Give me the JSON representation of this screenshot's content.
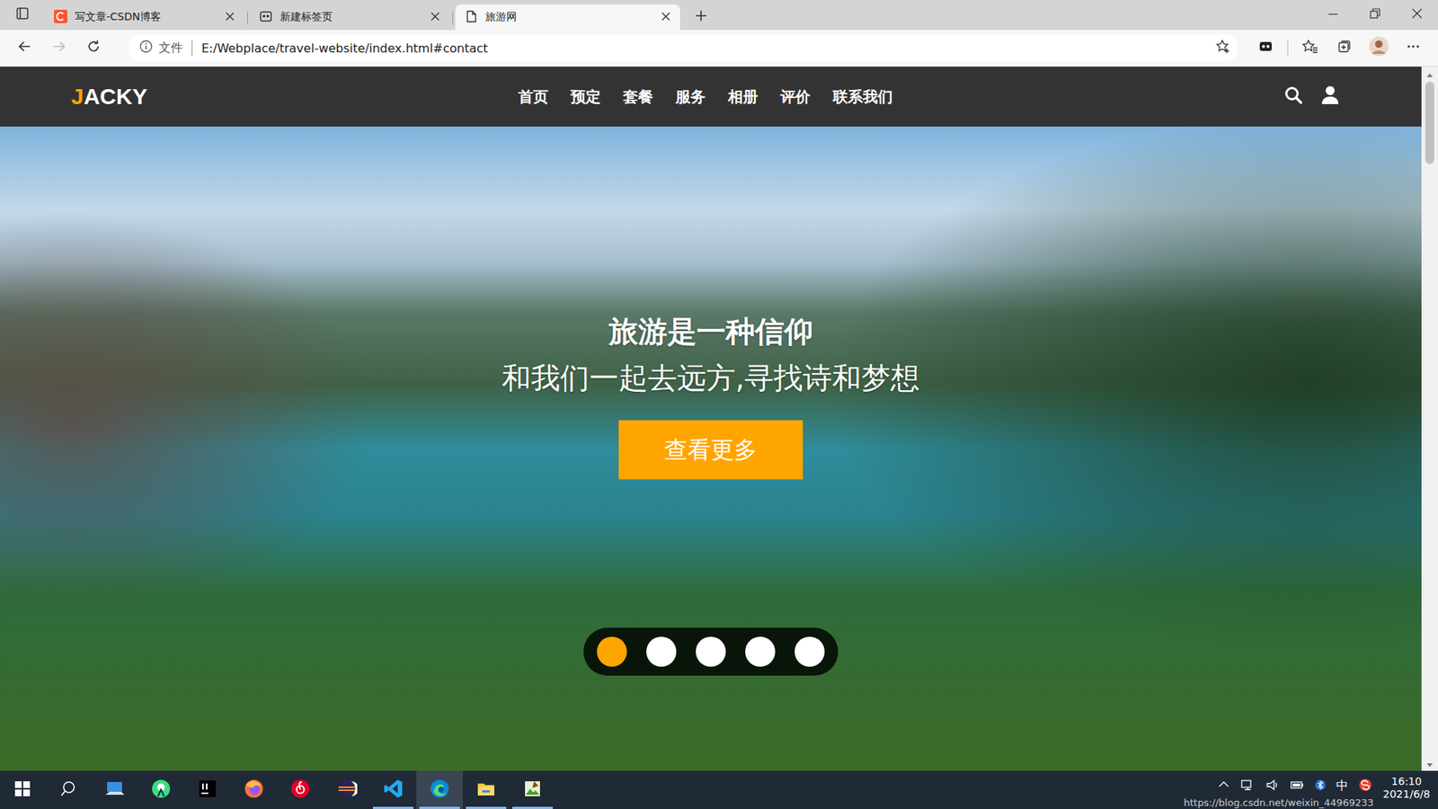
{
  "browser": {
    "tabs": [
      {
        "label": "写文章-CSDN博客",
        "selected": false
      },
      {
        "label": "新建标签页",
        "selected": false
      },
      {
        "label": "旅游网",
        "selected": true
      }
    ],
    "address": {
      "scheme": "文件",
      "url": "E:/Webplace/travel-website/index.html#contact"
    }
  },
  "site": {
    "logo": {
      "accent": "J",
      "rest": "ACKY"
    },
    "nav": [
      "首页",
      "预定",
      "套餐",
      "服务",
      "相册",
      "评价",
      "联系我们"
    ],
    "hero": {
      "title": "旅游是一种信仰",
      "subtitle": "和我们一起去远方,寻找诗和梦想",
      "button": "查看更多"
    },
    "slider": [
      {
        "selected": true
      },
      {
        "selected": false
      },
      {
        "selected": false
      },
      {
        "selected": false
      },
      {
        "selected": false
      }
    ]
  },
  "taskbar": {
    "apps": [
      {
        "running": false,
        "active": false
      },
      {
        "running": false,
        "active": false
      },
      {
        "running": false,
        "active": false
      },
      {
        "running": false,
        "active": false
      },
      {
        "running": false,
        "active": false
      },
      {
        "running": false,
        "active": false
      },
      {
        "running": true,
        "active": false
      },
      {
        "running": true,
        "active": true
      },
      {
        "running": true,
        "active": false
      },
      {
        "running": true,
        "active": false
      }
    ],
    "ime": "中",
    "clock": {
      "time": "16:10",
      "date": "2021/6/8"
    }
  },
  "watermark": "https://blog.csdn.net/weixin_44969233"
}
